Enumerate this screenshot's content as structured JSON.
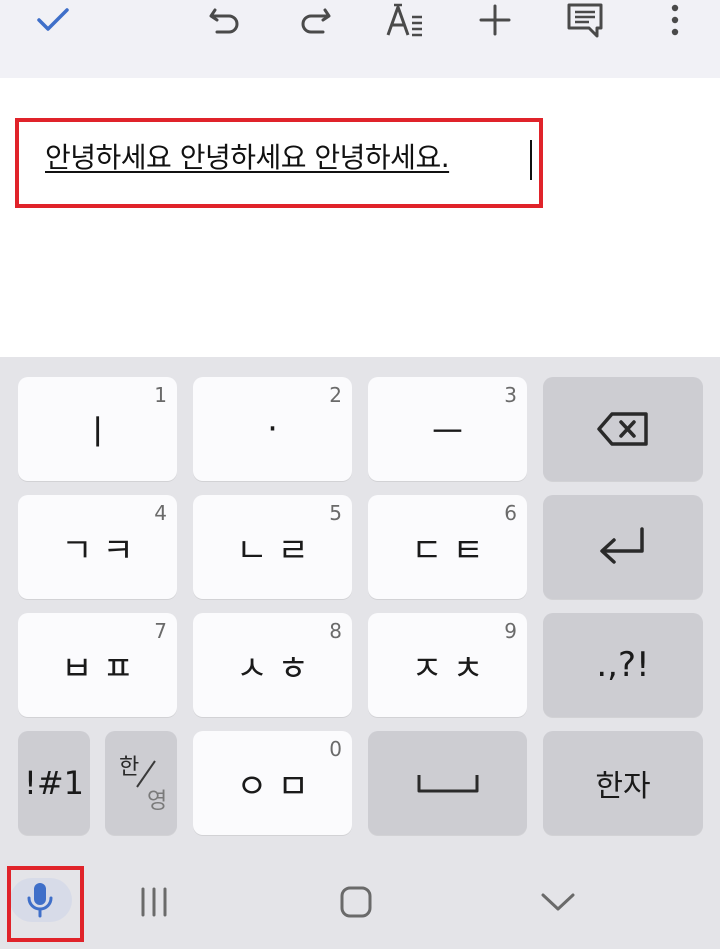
{
  "document": {
    "text": "안녕하세요 안녕하세요 안녕하세요."
  },
  "toolbar": {
    "icons": [
      "check-icon",
      "undo-icon",
      "redo-icon",
      "text-format-icon",
      "add-icon",
      "comment-icon",
      "more-vert-icon"
    ]
  },
  "keyboard": {
    "row1": [
      {
        "label": "ㅣ",
        "num": "1"
      },
      {
        "label": "·",
        "num": "2"
      },
      {
        "label": "ㅡ",
        "num": "3"
      }
    ],
    "row2": [
      {
        "label": "ㄱㅋ",
        "num": "4"
      },
      {
        "label": "ㄴㄹ",
        "num": "5"
      },
      {
        "label": "ㄷㅌ",
        "num": "6"
      }
    ],
    "row3": [
      {
        "label": "ㅂㅍ",
        "num": "7"
      },
      {
        "label": "ㅅㅎ",
        "num": "8"
      },
      {
        "label": "ㅈㅊ",
        "num": "9"
      }
    ],
    "punct_label": ".,?!",
    "symbols_label": "!#1",
    "lang_han": "한",
    "lang_yeong": "영",
    "row4_key": {
      "label": "ㅇㅁ",
      "num": "0"
    },
    "hanja_label": "한자"
  },
  "colors": {
    "highlight": "#e0232a",
    "accent": "#3f6fc9",
    "toolbar_bg": "#f1f1f6",
    "keyboard_bg": "#e4e4e8"
  }
}
